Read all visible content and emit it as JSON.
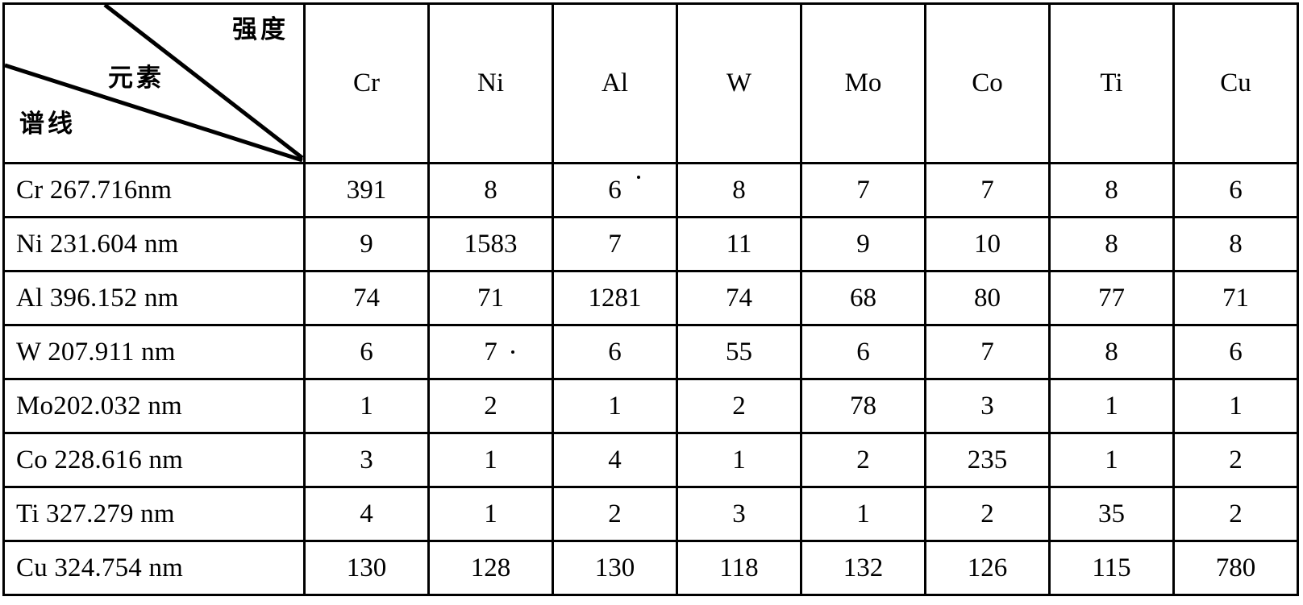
{
  "table": {
    "corner": {
      "intensity_label": "强度",
      "element_label": "元素",
      "spectral_label": "谱线"
    },
    "column_headers": [
      "Cr",
      "Ni",
      "Al",
      "W",
      "Mo",
      "Co",
      "Ti",
      "Cu"
    ],
    "rows": [
      {
        "label": "Cr 267.716nm",
        "values": [
          "391",
          "8",
          "6",
          "8",
          "7",
          "7",
          "8",
          "6"
        ]
      },
      {
        "label": "Ni 231.604 nm",
        "values": [
          "9",
          "1583",
          "7",
          "11",
          "9",
          "10",
          "8",
          "8"
        ]
      },
      {
        "label": "Al 396.152 nm",
        "values": [
          "74",
          "71",
          "1281",
          "74",
          "68",
          "80",
          "77",
          "71"
        ]
      },
      {
        "label": "W 207.911 nm",
        "values": [
          "6",
          "7",
          "6",
          "55",
          "6",
          "7",
          "8",
          "6"
        ]
      },
      {
        "label": "Mo202.032 nm",
        "values": [
          "1",
          "2",
          "1",
          "2",
          "78",
          "3",
          "1",
          "1"
        ]
      },
      {
        "label": "Co 228.616 nm",
        "values": [
          "3",
          "1",
          "4",
          "1",
          "2",
          "235",
          "1",
          "2"
        ]
      },
      {
        "label": "Ti 327.279 nm",
        "values": [
          "4",
          "1",
          "2",
          "3",
          "1",
          "2",
          "35",
          "2"
        ]
      },
      {
        "label": "Cu 324.754 nm",
        "values": [
          "130",
          "128",
          "130",
          "118",
          "132",
          "126",
          "115",
          "780"
        ]
      }
    ]
  },
  "chart_data": {
    "type": "table",
    "title": "",
    "row_axis_label": "谱线",
    "column_axis_label": "元素",
    "value_label": "强度",
    "categories": [
      "Cr",
      "Ni",
      "Al",
      "W",
      "Mo",
      "Co",
      "Ti",
      "Cu"
    ],
    "row_categories": [
      "Cr 267.716nm",
      "Ni 231.604 nm",
      "Al 396.152 nm",
      "W 207.911 nm",
      "Mo202.032 nm",
      "Co 228.616 nm",
      "Ti 327.279 nm",
      "Cu 324.754 nm"
    ],
    "series": [
      {
        "name": "Cr 267.716nm",
        "values": [
          391,
          8,
          6,
          8,
          7,
          7,
          8,
          6
        ]
      },
      {
        "name": "Ni 231.604 nm",
        "values": [
          9,
          1583,
          7,
          11,
          9,
          10,
          8,
          8
        ]
      },
      {
        "name": "Al 396.152 nm",
        "values": [
          74,
          71,
          1281,
          74,
          68,
          80,
          77,
          71
        ]
      },
      {
        "name": "W 207.911 nm",
        "values": [
          6,
          7,
          6,
          55,
          6,
          7,
          8,
          6
        ]
      },
      {
        "name": "Mo202.032 nm",
        "values": [
          1,
          2,
          1,
          2,
          78,
          3,
          1,
          1
        ]
      },
      {
        "name": "Co 228.616 nm",
        "values": [
          3,
          1,
          4,
          1,
          2,
          235,
          1,
          2
        ]
      },
      {
        "name": "Ti 327.279 nm",
        "values": [
          4,
          1,
          2,
          3,
          1,
          2,
          35,
          2
        ]
      },
      {
        "name": "Cu 324.754 nm",
        "values": [
          130,
          128,
          130,
          118,
          132,
          126,
          115,
          780
        ]
      }
    ]
  },
  "colors": {
    "border": "#000000",
    "text": "#000000",
    "background": "#ffffff"
  }
}
